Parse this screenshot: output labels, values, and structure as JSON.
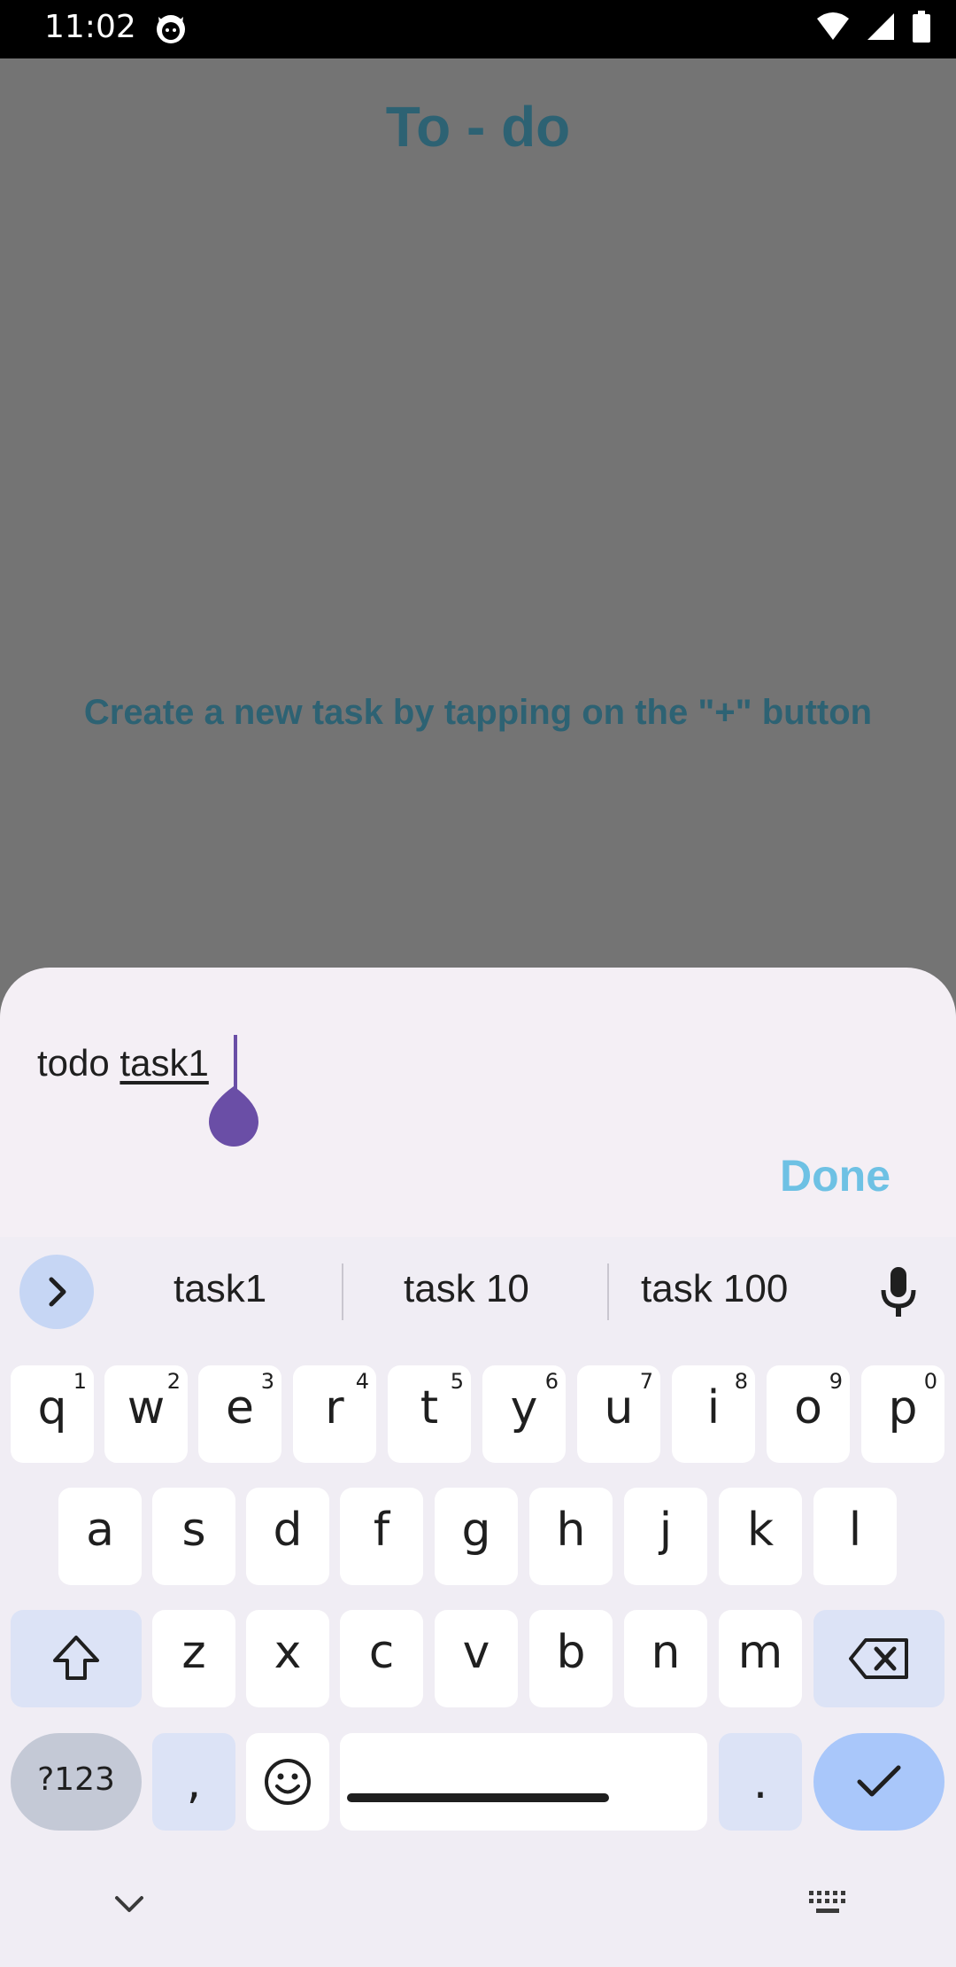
{
  "status_bar": {
    "time": "11:02"
  },
  "app": {
    "title": "To - do",
    "empty_message": "Create a new task by tapping on the \"+\" button"
  },
  "sheet": {
    "input_prefix": "todo ",
    "input_composing": "task1",
    "done_label": "Done"
  },
  "keyboard": {
    "suggestions": [
      "task1",
      "task 10",
      "task 100"
    ],
    "row1": [
      {
        "label": "q",
        "hint": "1"
      },
      {
        "label": "w",
        "hint": "2"
      },
      {
        "label": "e",
        "hint": "3"
      },
      {
        "label": "r",
        "hint": "4"
      },
      {
        "label": "t",
        "hint": "5"
      },
      {
        "label": "y",
        "hint": "6"
      },
      {
        "label": "u",
        "hint": "7"
      },
      {
        "label": "i",
        "hint": "8"
      },
      {
        "label": "o",
        "hint": "9"
      },
      {
        "label": "p",
        "hint": "0"
      }
    ],
    "row2": [
      "a",
      "s",
      "d",
      "f",
      "g",
      "h",
      "j",
      "k",
      "l"
    ],
    "row3": [
      "z",
      "x",
      "c",
      "v",
      "b",
      "n",
      "m"
    ],
    "symbols_label": "?123",
    "comma_label": ",",
    "period_label": ".",
    "accent_color": "#a9c7fa"
  }
}
